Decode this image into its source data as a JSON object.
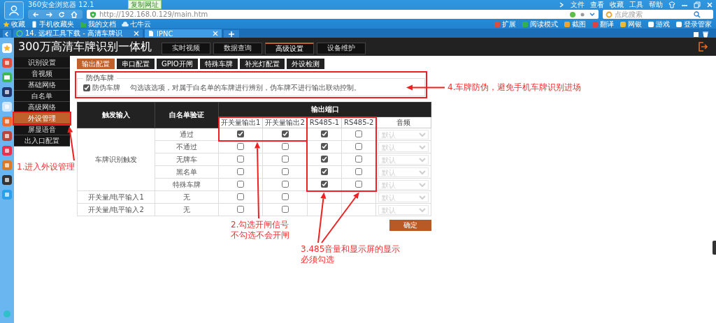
{
  "browser": {
    "title": "360安全浏览器 12.1",
    "menu": [
      "文件",
      "查看",
      "收藏",
      "工具",
      "帮助"
    ],
    "copy_url": "复制网址",
    "url": "http://192.168.0.129/main.htm",
    "search": {
      "placeholder": "点此搜索"
    },
    "bookmarks": [
      "收藏",
      "手机收藏夹",
      "我的文档",
      "七牛云"
    ],
    "tools": [
      "扩展",
      "阅读模式",
      "截图",
      "翻译",
      "网银",
      "游戏",
      "登录管家"
    ],
    "tabs": [
      {
        "label": "14. 远程工具下载 - 高清车牌识",
        "selected": false
      },
      {
        "label": "IPNC",
        "selected": true
      }
    ]
  },
  "app": {
    "title": "300万高清车牌识别一体机",
    "nav": [
      {
        "label": "实时视频",
        "selected": false
      },
      {
        "label": "数据查询",
        "selected": false
      },
      {
        "label": "高级设置",
        "selected": true
      },
      {
        "label": "设备维护",
        "selected": false
      }
    ],
    "menu": [
      {
        "label": "识别设置",
        "selected": false
      },
      {
        "label": "音视频",
        "selected": false
      },
      {
        "label": "基础网络",
        "selected": false
      },
      {
        "label": "白名单",
        "selected": false
      },
      {
        "label": "高级网络",
        "selected": false
      },
      {
        "label": "外设管理",
        "selected": true
      },
      {
        "label": "屏显语音",
        "selected": false
      },
      {
        "label": "出入口配置",
        "selected": false
      }
    ],
    "subtabs": [
      {
        "label": "输出配置",
        "selected": true
      },
      {
        "label": "串口配置",
        "selected": false
      },
      {
        "label": "GPIO开闸",
        "selected": false
      },
      {
        "label": "特殊车牌",
        "selected": false
      },
      {
        "label": "补光灯配置",
        "selected": false
      },
      {
        "label": "外设检测",
        "selected": false
      }
    ],
    "anti_fake": {
      "legend": "防伪车牌",
      "label": "防伪车牌",
      "checked": true,
      "description": "勾选该选项，对属于白名单的车牌进行辨别，伪车牌不进行输出联动控制。"
    },
    "table": {
      "columns": [
        "触发输入",
        "白名单验证"
      ],
      "group_header": "输出端口",
      "subcolumns": [
        "开关量输出1",
        "开关量输出2",
        "RS485-1",
        "RS485-2",
        "音频"
      ],
      "groups": [
        {
          "trigger": "车牌识别触发",
          "rows": [
            {
              "check": "通过",
              "outputs": [
                true,
                true
              ],
              "rs485": [
                true,
                false
              ],
              "audio": {
                "value": "默认",
                "disabled": true
              }
            },
            {
              "check": "不通过",
              "outputs": [
                false,
                false
              ],
              "rs485": [
                true,
                false
              ],
              "audio": {
                "value": "默认",
                "disabled": true
              }
            },
            {
              "check": "无牌车",
              "outputs": [
                false,
                false
              ],
              "rs485": [
                true,
                false
              ],
              "audio": {
                "value": "默认",
                "disabled": true
              }
            },
            {
              "check": "黑名单",
              "outputs": [
                false,
                false
              ],
              "rs485": [
                true,
                false
              ],
              "audio": {
                "value": "默认",
                "disabled": true
              }
            },
            {
              "check": "特殊车牌",
              "outputs": [
                false,
                false
              ],
              "rs485": [
                true,
                false
              ],
              "audio": {
                "value": "默认",
                "disabled": true
              }
            }
          ]
        },
        {
          "trigger": "开关量/电平输入1",
          "rows": [
            {
              "check": "无",
              "outputs": [
                false,
                false
              ],
              "audio": {
                "value": "默认",
                "disabled": true
              }
            }
          ]
        },
        {
          "trigger": "开关量/电平输入2",
          "rows": [
            {
              "check": "无",
              "outputs": [
                false,
                false
              ],
              "audio": {
                "value": "默认",
                "disabled": true
              }
            }
          ]
        }
      ]
    },
    "confirm": "确定"
  },
  "annotations": [
    {
      "text": "1.进入外设管理",
      "kind": "menu"
    },
    {
      "text": "2.勾选开闸信号不勾选不会开闸",
      "kind": "outputs"
    },
    {
      "text": "3.485音量和显示屏的显示必须勾选",
      "kind": "rs485"
    },
    {
      "text": "4.车牌防伪，避免手机车牌识别进场",
      "kind": "antifake"
    }
  ]
}
